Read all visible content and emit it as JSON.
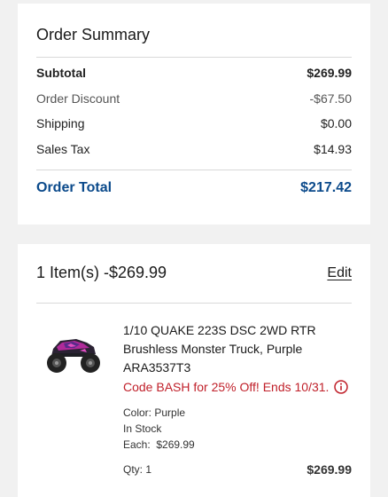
{
  "summary": {
    "title": "Order Summary",
    "rows": [
      {
        "label": "Subtotal",
        "value": "$269.99"
      },
      {
        "label": "Order Discount",
        "value": "-$67.50"
      },
      {
        "label": "Shipping",
        "value": "$0.00"
      },
      {
        "label": "Sales Tax",
        "value": "$14.93"
      }
    ],
    "total": {
      "label": "Order Total",
      "value": "$217.42"
    }
  },
  "cart": {
    "count_label": "1 Item(s) -$269.99",
    "edit_label": "Edit",
    "item": {
      "name_line1": "1/10 QUAKE 223S DSC 2WD RTR",
      "name_line2": "Brushless Monster Truck, Purple",
      "sku": "ARA3537T3",
      "promo": "Code BASH for 25% Off! Ends 10/31.",
      "color": "Color: Purple",
      "stock": "In Stock",
      "each": "Each:  $269.99",
      "qty": "Qty: 1",
      "price": "$269.99",
      "image_icon": "monster-truck-image",
      "promo_icon": "info-circle-icon"
    }
  },
  "colors": {
    "accent": "#0b4a8b",
    "promo": "#c0202a",
    "background": "#f1f1f1"
  }
}
